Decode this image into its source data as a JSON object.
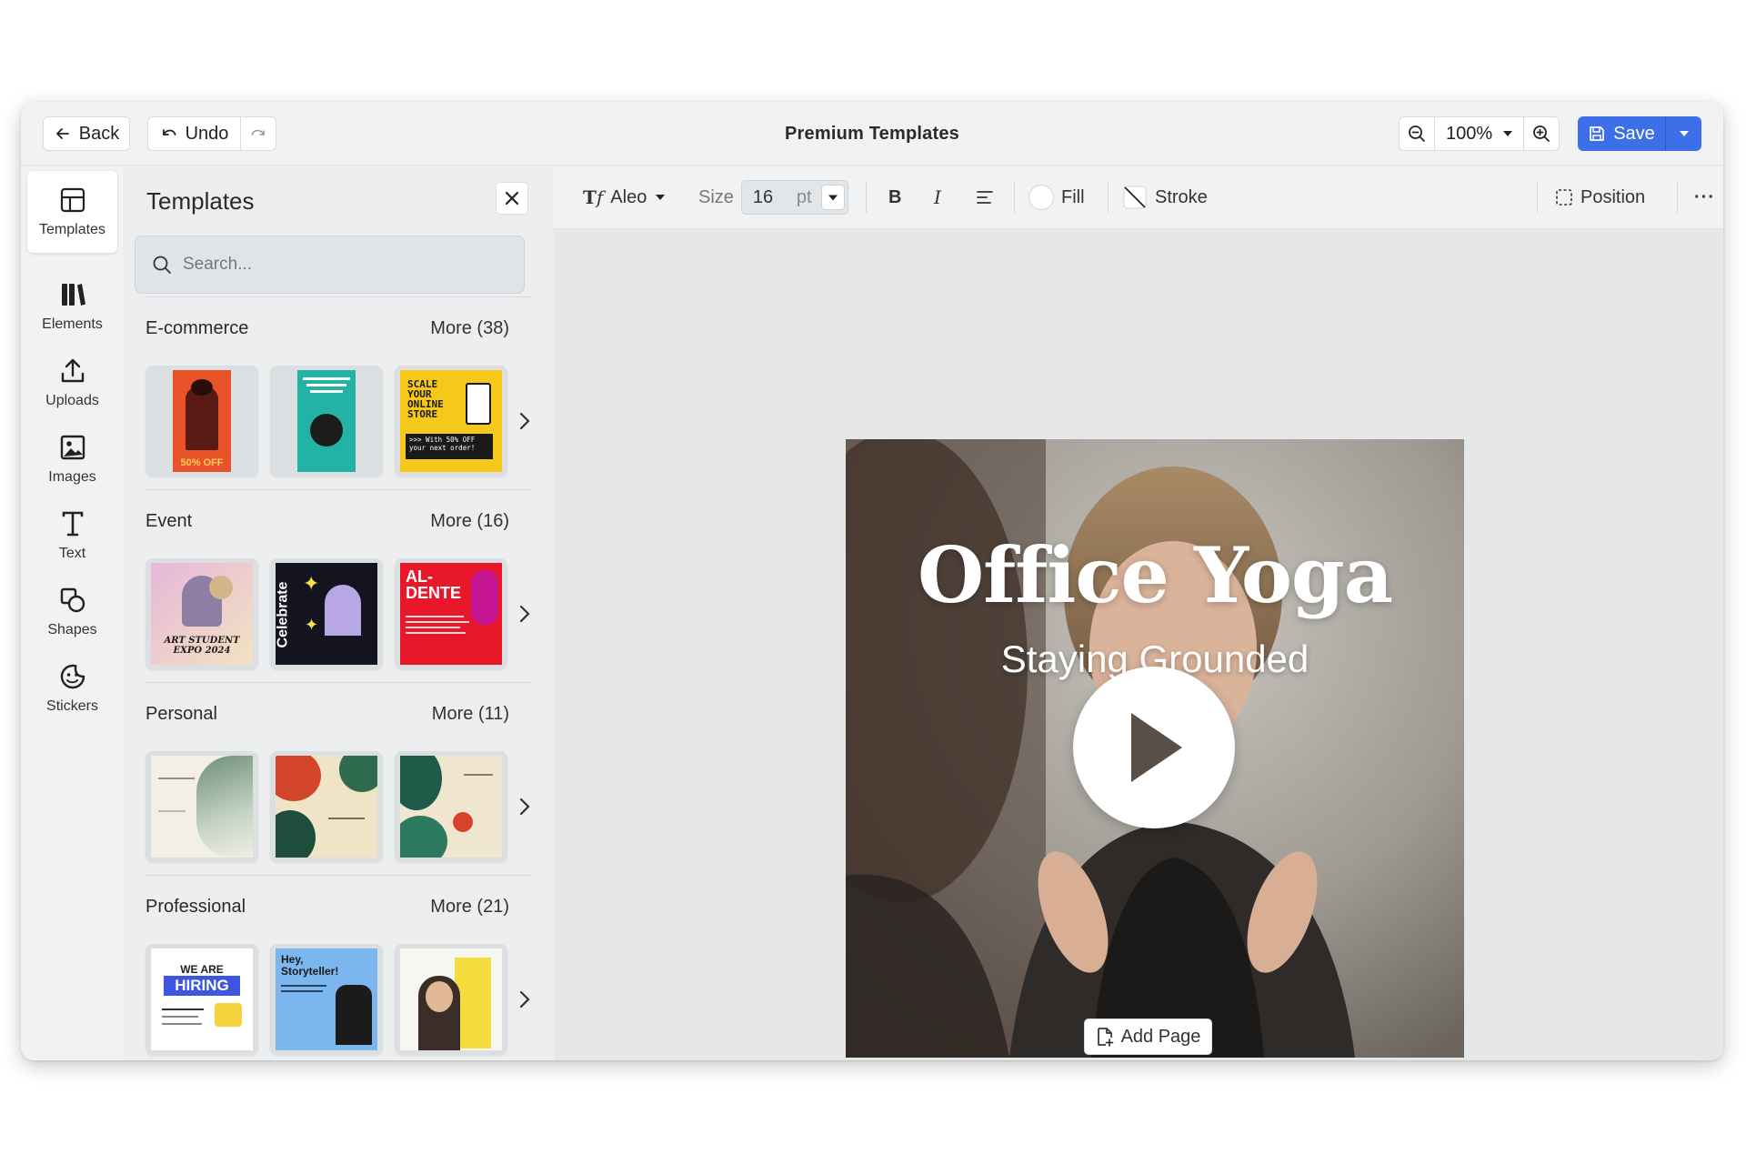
{
  "topbar": {
    "back_label": "Back",
    "undo_label": "Undo",
    "title": "Premium Templates",
    "zoom": "100%",
    "save_label": "Save"
  },
  "rail": {
    "items": [
      {
        "label": "Templates",
        "icon": "templates-icon"
      },
      {
        "label": "Elements",
        "icon": "elements-icon"
      },
      {
        "label": "Uploads",
        "icon": "upload-icon"
      },
      {
        "label": "Images",
        "icon": "image-icon"
      },
      {
        "label": "Text",
        "icon": "text-icon"
      },
      {
        "label": "Shapes",
        "icon": "shapes-icon"
      },
      {
        "label": "Stickers",
        "icon": "sticker-icon"
      }
    ]
  },
  "panel": {
    "title": "Templates",
    "search_placeholder": "Search...",
    "sections": [
      {
        "name": "E-commerce",
        "more": "More (38)"
      },
      {
        "name": "Event",
        "more": "More (16)"
      },
      {
        "name": "Personal",
        "more": "More (11)"
      },
      {
        "name": "Professional",
        "more": "More (21)"
      }
    ],
    "thumb_text": {
      "scale": "SCALE YOUR ONLINE STORE",
      "offer": ">>> With 50% OFF your next order!",
      "discount": "50% OFF",
      "art_expo": "ART STUDENT EXPO 2024",
      "celebrate": "Celebrate",
      "al_dente": "AL- DENTE",
      "hiring_top": "WE ARE",
      "hiring": "HIRING",
      "storyteller": "Hey, Storyteller!"
    }
  },
  "format": {
    "font": "Aleo",
    "size_label": "Size",
    "size_value": "16",
    "size_unit": "pt",
    "bold": "B",
    "italic": "I",
    "fill_label": "Fill",
    "stroke_label": "Stroke",
    "position_label": "Position",
    "more": "···"
  },
  "design": {
    "title": "Office Yoga",
    "subtitle": "Staying Grounded"
  },
  "canvas": {
    "add_page_label": "Add Page"
  },
  "colors": {
    "accent": "#3c6fe8",
    "window_bg": "#eceeef",
    "canvas_bg": "#e5e7e9"
  }
}
